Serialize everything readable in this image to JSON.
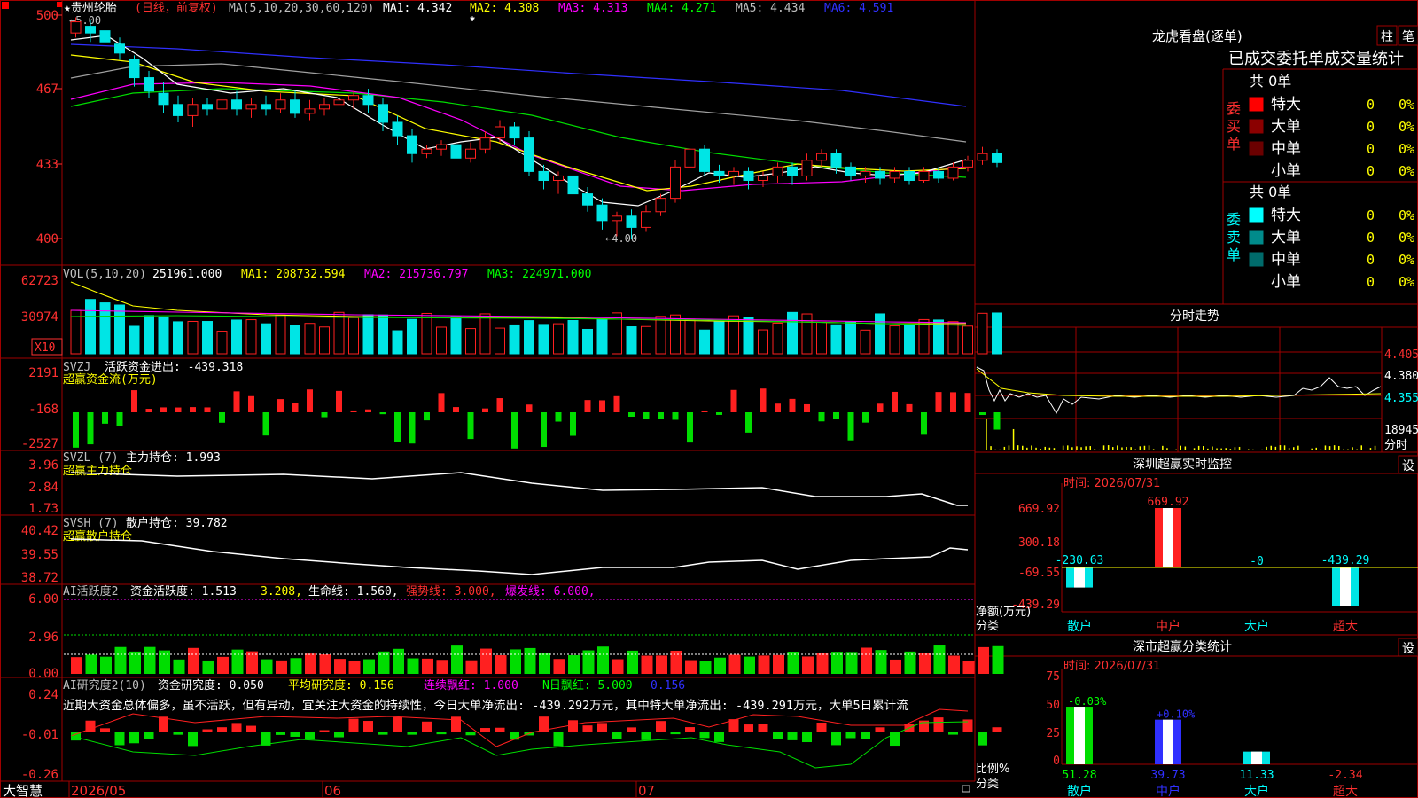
{
  "colors": {
    "up": "#ff2020",
    "down": "#00e5e5",
    "green": "#00dd00",
    "yellow": "#ffff00",
    "magenta": "#ff00ff",
    "white": "#ffffff",
    "blue": "#3030ff",
    "gray": "#a0a0a0",
    "grid": "#a00000"
  },
  "main_header": {
    "stock": "★贵州轮胎",
    "mode": "(日线，前复权)",
    "ma_params": "MA(5,10,20,30,60,120)",
    "ma1": "MA1: 4.342",
    "ma2": "MA2: 4.308",
    "ma3": "MA3: 4.313",
    "ma4": "MA4: 4.271",
    "ma5": "MA5: 4.434",
    "ma6": "MA6: 4.591",
    "star": "✱"
  },
  "price_axis": {
    "ticks": [
      "500",
      "467",
      "433",
      "400"
    ],
    "high_mark": "←5.00",
    "low_mark": "←4.00"
  },
  "volume_panel": {
    "header": "VOL(5,10,20)",
    "value": "251961.000",
    "ma1": "MA1: 208732.594",
    "ma2": "MA2: 215736.797",
    "ma3": "MA3: 224971.000",
    "ticks": [
      "62723",
      "30974"
    ],
    "unit": "X10"
  },
  "svzj_panel": {
    "header": "SVZJ",
    "label": "活跃资金进出: -439.318",
    "sub": "超赢资金流(万元)",
    "ticks": [
      "2191",
      "-168",
      "-2527"
    ]
  },
  "svzl_panel": {
    "header": "SVZL (7)",
    "label": "主力持仓: 1.993",
    "sub": "超赢主力持仓",
    "ticks": [
      "3.96",
      "2.84",
      "1.73"
    ]
  },
  "svsh_panel": {
    "header": "SVSH (7)",
    "label": "散户持仓: 39.782",
    "sub": "超赢散户持仓",
    "ticks": [
      "40.42",
      "39.55",
      "38.72"
    ]
  },
  "ai_active_panel": {
    "header": "AI活跃度2",
    "label": "资金活跃度: 1.513",
    "v2": "3.208,",
    "life": "生命线: 1.560,",
    "strong": "强势线: 3.000,",
    "burst": "爆发线: 6.000,",
    "ticks": [
      "6.00",
      "2.96",
      "0.00"
    ]
  },
  "ai_research_panel": {
    "header": "AI研究度2(10)",
    "label": "资金研究度: 0.050",
    "avg": "平均研究度: 0.156",
    "cont": "连续飘红: 1.000",
    "n": "N日飘红: 5.000",
    "last": "0.156",
    "text": "近期大资金总体偏多，虽不活跃，但有异动，宜关注大资金的持续性，今日大单净流出: -439.292万元，其中特大单净流出: -439.291万元，大单5日累计流",
    "ticks": [
      "0.24",
      "-0.01",
      "-0.26"
    ]
  },
  "date_axis": {
    "brand": "大智慧",
    "labels": [
      "2026/05",
      "06",
      "07"
    ]
  },
  "lhb_panel": {
    "title": "龙虎看盘(逐单)",
    "btn1": "柱",
    "btn2": "笔",
    "heading": "已成交委托单成交量统计",
    "buy_label": "委买单",
    "sell_label": "委卖单",
    "buy_total": "共 0单",
    "sell_total": "共 0单",
    "buy_rows": [
      {
        "name": "特大",
        "val": "0",
        "pct": "0%",
        "color": "#ff0000"
      },
      {
        "name": "大单",
        "val": "0",
        "pct": "0%",
        "color": "#8b0000"
      },
      {
        "name": "中单",
        "val": "0",
        "pct": "0%",
        "color": "#6b0000"
      },
      {
        "name": "小单",
        "val": "0",
        "pct": "0%",
        "color": "#000000"
      }
    ],
    "sell_rows": [
      {
        "name": "特大",
        "val": "0",
        "pct": "0%",
        "color": "#00ffff"
      },
      {
        "name": "大单",
        "val": "0",
        "pct": "0%",
        "color": "#008b8b"
      },
      {
        "name": "中单",
        "val": "0",
        "pct": "0%",
        "color": "#006b6b"
      },
      {
        "name": "小单",
        "val": "0",
        "pct": "0%",
        "color": "#000000"
      }
    ]
  },
  "intraday_panel": {
    "title": "分时走势",
    "prices": [
      "4.405",
      "4.380",
      "4.355"
    ],
    "vol": "18945",
    "vol_label": "分时"
  },
  "sz_monitor": {
    "title": "深圳超赢实时监控",
    "btn": "设",
    "time": "时间: 2026/07/31",
    "ticks": [
      "669.92",
      "300.18",
      "-69.55",
      "-439.29"
    ],
    "axis_label": "净额(万元)",
    "cat_label": "分类",
    "bars": [
      {
        "cat": "散户",
        "value": -230.63,
        "label": "-230.63"
      },
      {
        "cat": "中户",
        "value": 669.92,
        "label": "669.92"
      },
      {
        "cat": "大户",
        "value": 0,
        "label": "-0"
      },
      {
        "cat": "超大",
        "value": -439.29,
        "label": "-439.29"
      }
    ]
  },
  "sz_class": {
    "title": "深市超赢分类统计",
    "btn": "设",
    "time": "时间: 2026/07/31",
    "ticks": [
      "75",
      "50",
      "25",
      "0"
    ],
    "axis_label": "比例%",
    "cat_label": "分类",
    "bars": [
      {
        "cat": "散户",
        "value": 51.28,
        "label": "51.28",
        "chg": "-0.03%"
      },
      {
        "cat": "中户",
        "value": 39.73,
        "label": "39.73",
        "chg": "+0.10%"
      },
      {
        "cat": "大户",
        "value": 11.33,
        "label": "11.33",
        "chg": ""
      },
      {
        "cat": "超大",
        "value": -2.34,
        "label": "-2.34",
        "chg": ""
      }
    ]
  },
  "chart_data": {
    "type": "candlestick",
    "price_range": [
      4.0,
      5.0
    ],
    "note_axis": "price ×100 shown",
    "candles": [
      [
        4.92,
        4.97,
        4.99,
        4.9
      ],
      [
        4.95,
        4.92,
        4.98,
        4.88
      ],
      [
        4.93,
        4.88,
        4.96,
        4.86
      ],
      [
        4.87,
        4.83,
        4.9,
        4.8
      ],
      [
        4.8,
        4.72,
        4.82,
        4.68
      ],
      [
        4.72,
        4.66,
        4.75,
        4.63
      ],
      [
        4.65,
        4.6,
        4.7,
        4.56
      ],
      [
        4.6,
        4.55,
        4.64,
        4.52
      ],
      [
        4.55,
        4.6,
        4.63,
        4.5
      ],
      [
        4.6,
        4.58,
        4.63,
        4.55
      ],
      [
        4.58,
        4.62,
        4.65,
        4.54
      ],
      [
        4.62,
        4.58,
        4.66,
        4.55
      ],
      [
        4.58,
        4.6,
        4.63,
        4.54
      ],
      [
        4.6,
        4.58,
        4.64,
        4.55
      ],
      [
        4.58,
        4.62,
        4.65,
        4.56
      ],
      [
        4.62,
        4.56,
        4.66,
        4.54
      ],
      [
        4.56,
        4.58,
        4.62,
        4.53
      ],
      [
        4.58,
        4.6,
        4.63,
        4.55
      ],
      [
        4.6,
        4.62,
        4.64,
        4.57
      ],
      [
        4.62,
        4.64,
        4.66,
        4.58
      ],
      [
        4.64,
        4.6,
        4.67,
        4.56
      ],
      [
        4.6,
        4.52,
        4.63,
        4.48
      ],
      [
        4.52,
        4.46,
        4.55,
        4.42
      ],
      [
        4.46,
        4.38,
        4.49,
        4.34
      ],
      [
        4.38,
        4.4,
        4.42,
        4.36
      ],
      [
        4.4,
        4.42,
        4.44,
        4.37
      ],
      [
        4.42,
        4.36,
        4.45,
        4.33
      ],
      [
        4.36,
        4.4,
        4.43,
        4.34
      ],
      [
        4.4,
        4.45,
        4.48,
        4.38
      ],
      [
        4.45,
        4.5,
        4.53,
        4.43
      ],
      [
        4.5,
        4.45,
        4.52,
        4.42
      ],
      [
        4.45,
        4.3,
        4.48,
        4.28
      ],
      [
        4.3,
        4.26,
        4.33,
        4.22
      ],
      [
        4.26,
        4.28,
        4.3,
        4.2
      ],
      [
        4.28,
        4.2,
        4.31,
        4.17
      ],
      [
        4.2,
        4.15,
        4.23,
        4.12
      ],
      [
        4.15,
        4.08,
        4.18,
        4.04
      ],
      [
        4.08,
        4.1,
        4.12,
        4.01
      ],
      [
        4.1,
        4.05,
        4.13,
        4.0
      ],
      [
        4.05,
        4.12,
        4.15,
        4.03
      ],
      [
        4.12,
        4.18,
        4.2,
        4.1
      ],
      [
        4.18,
        4.32,
        4.35,
        4.16
      ],
      [
        4.32,
        4.4,
        4.43,
        4.3
      ],
      [
        4.4,
        4.3,
        4.42,
        4.28
      ],
      [
        4.3,
        4.28,
        4.33,
        4.25
      ],
      [
        4.28,
        4.3,
        4.32,
        4.24
      ],
      [
        4.3,
        4.26,
        4.32,
        4.22
      ],
      [
        4.26,
        4.28,
        4.3,
        4.23
      ],
      [
        4.28,
        4.32,
        4.34,
        4.25
      ],
      [
        4.32,
        4.28,
        4.34,
        4.24
      ],
      [
        4.28,
        4.35,
        4.38,
        4.26
      ],
      [
        4.35,
        4.38,
        4.4,
        4.32
      ],
      [
        4.38,
        4.32,
        4.4,
        4.29
      ],
      [
        4.32,
        4.28,
        4.34,
        4.26
      ],
      [
        4.28,
        4.3,
        4.32,
        4.25
      ],
      [
        4.3,
        4.27,
        4.32,
        4.24
      ],
      [
        4.27,
        4.3,
        4.32,
        4.25
      ],
      [
        4.3,
        4.26,
        4.32,
        4.24
      ],
      [
        4.26,
        4.3,
        4.32,
        4.25
      ],
      [
        4.3,
        4.27,
        4.32,
        4.25
      ],
      [
        4.27,
        4.32,
        4.34,
        4.26
      ],
      [
        4.32,
        4.35,
        4.37,
        4.3
      ],
      [
        4.35,
        4.38,
        4.41,
        4.33
      ],
      [
        4.38,
        4.34,
        4.4,
        4.32
      ]
    ]
  }
}
